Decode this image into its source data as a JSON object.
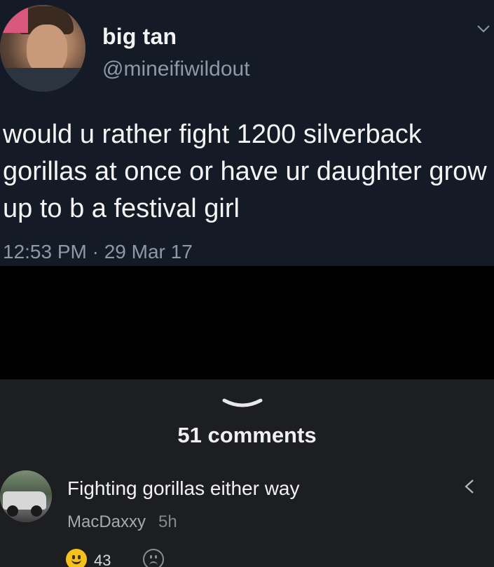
{
  "tweet": {
    "display_name": "big tan",
    "handle": "@mineifiwildout",
    "text": "would u rather fight 1200 silverback gorillas at once or have ur daughter grow up to b a festival girl",
    "timestamp": "12:53 PM · 29 Mar 17",
    "menu_icon": "chevron-down-icon"
  },
  "comments": {
    "count_label": "51 comments",
    "collapse_icon": "chevron-down-icon",
    "items": [
      {
        "text": "Fighting gorillas either way",
        "author": "MacDaxxy",
        "time": "5h",
        "likes": "43",
        "share_icon": "share-icon",
        "like_icon": "smiley-icon",
        "dislike_icon": "frown-icon"
      }
    ]
  },
  "colors": {
    "tweet_bg": "#141b26",
    "page_bg": "#1d1e22",
    "secondary_text": "#8e98a6",
    "like_yellow": "#f5c21b"
  }
}
